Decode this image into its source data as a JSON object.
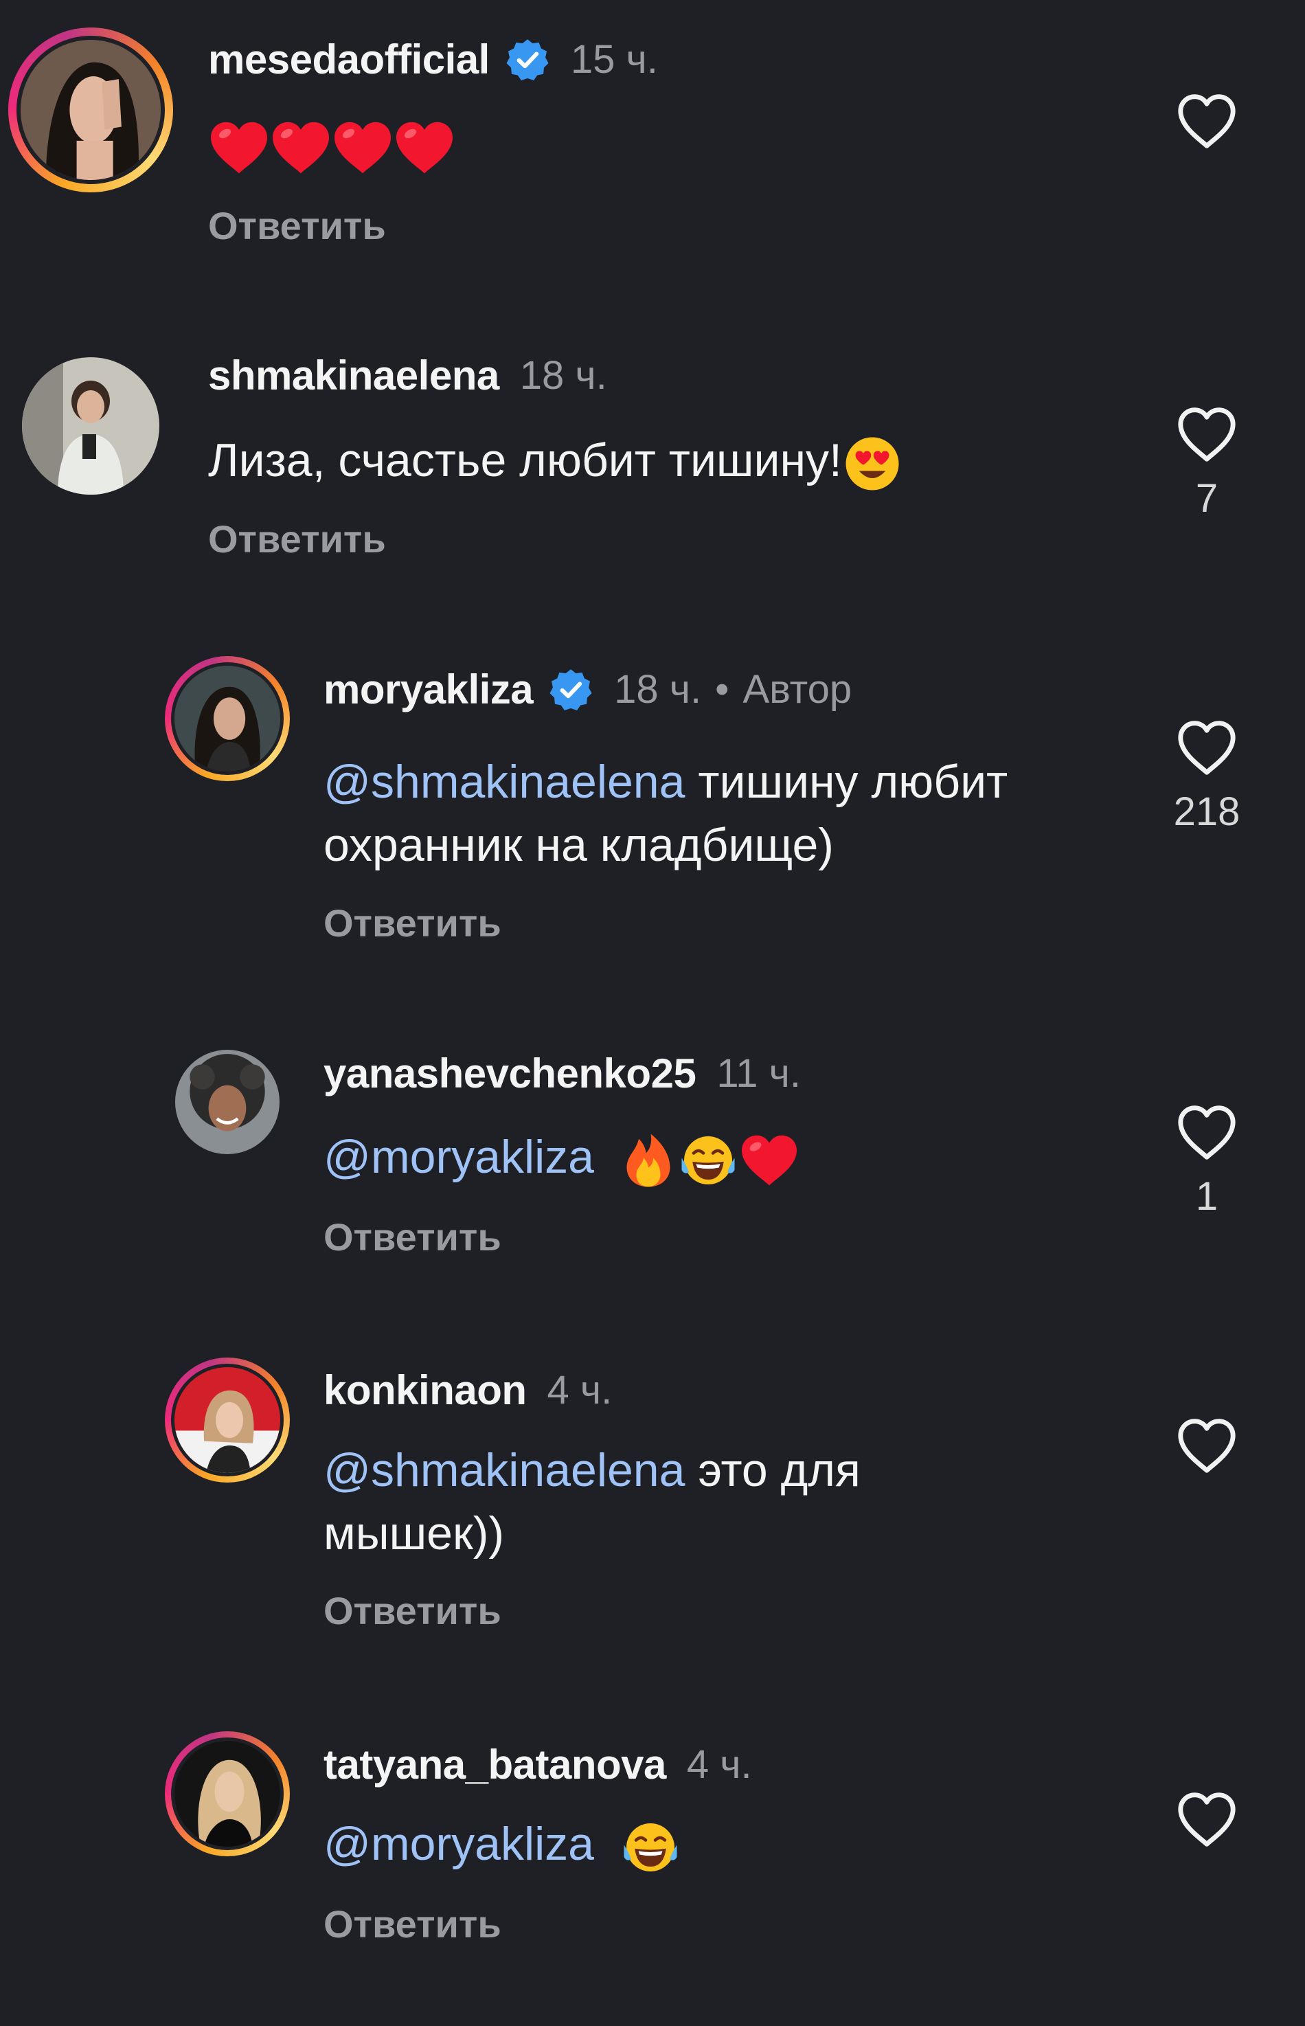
{
  "reply_label": "Ответить",
  "comments": [
    {
      "username": "mesedaofficial",
      "verified": true,
      "time": "15 ч.",
      "text_emojis": [
        "red-heart",
        "red-heart",
        "red-heart",
        "red-heart"
      ],
      "likes": ""
    },
    {
      "username": "shmakinaelena",
      "verified": false,
      "time": "18 ч.",
      "text": "Лиза, счастье любит тишину!",
      "text_emojis": [
        "heart-eyes-face"
      ],
      "likes": "7"
    },
    {
      "username": "moryakliza",
      "verified": true,
      "time": "18 ч.",
      "author_dot": "•",
      "author_label": "Автор",
      "mention": "@shmakinaelena",
      "text_line1": " тишину любит",
      "text_line2": "охранник на кладбище)",
      "likes": "218"
    },
    {
      "username": "yanashevchenko25",
      "verified": false,
      "time": "11 ч.",
      "mention": "@moryakliza",
      "text_emojis": [
        "fire",
        "tears-of-joy-face",
        "red-heart"
      ],
      "likes": "1"
    },
    {
      "username": "konkinaon",
      "verified": false,
      "time": "4 ч.",
      "mention": "@shmakinaelena",
      "text_line1": " это для",
      "text_line2": "мышек))",
      "likes": ""
    },
    {
      "username": "tatyana_batanova",
      "verified": false,
      "time": "4 ч.",
      "mention": "@moryakliza",
      "text_emojis": [
        "tears-of-joy-face"
      ],
      "likes": ""
    }
  ],
  "colors": {
    "background": "#1f2025",
    "mention": "#9fc2f7",
    "verified_badge": "#3897f0",
    "muted_text": "#9a9ba0"
  }
}
